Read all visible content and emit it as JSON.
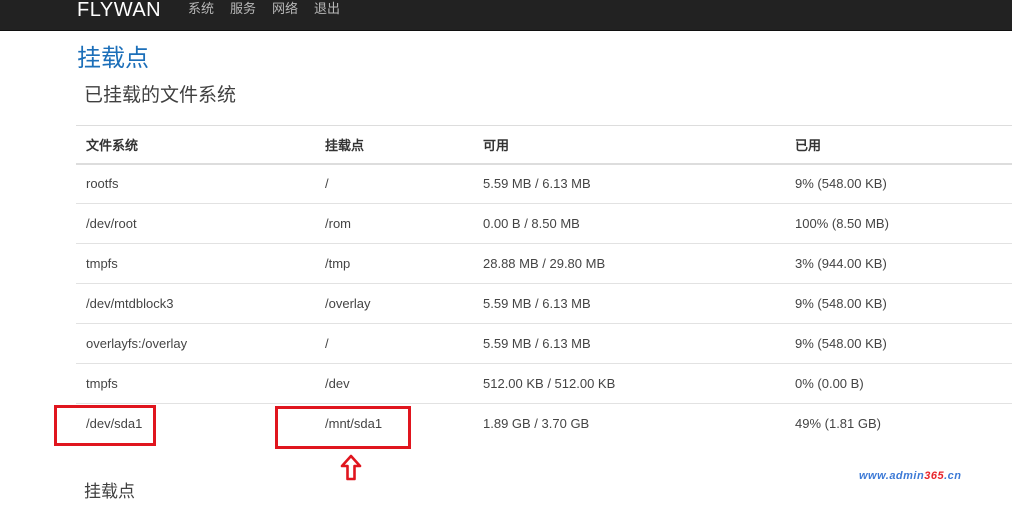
{
  "navbar": {
    "brand": "FLYWAN",
    "items": [
      "系统",
      "服务",
      "网络",
      "退出"
    ]
  },
  "page_title": "挂载点",
  "section_title": "已挂载的文件系统",
  "table": {
    "headers": [
      "文件系统",
      "挂载点",
      "可用",
      "已用"
    ],
    "rows": [
      [
        "rootfs",
        "/",
        "5.59 MB / 6.13 MB",
        "9% (548.00 KB)"
      ],
      [
        "/dev/root",
        "/rom",
        "0.00 B / 8.50 MB",
        "100% (8.50 MB)"
      ],
      [
        "tmpfs",
        "/tmp",
        "28.88 MB / 29.80 MB",
        "3% (944.00 KB)"
      ],
      [
        "/dev/mtdblock3",
        "/overlay",
        "5.59 MB / 6.13 MB",
        "9% (548.00 KB)"
      ],
      [
        "overlayfs:/overlay",
        "/",
        "5.59 MB / 6.13 MB",
        "9% (548.00 KB)"
      ],
      [
        "tmpfs",
        "/dev",
        "512.00 KB / 512.00 KB",
        "0% (0.00 B)"
      ],
      [
        "/dev/sda1",
        "/mnt/sda1",
        "1.89 GB / 3.70 GB",
        "49% (1.81 GB)"
      ]
    ]
  },
  "footer_title": "挂载点",
  "watermark": {
    "prefix": "www.admin",
    "highlight": "365",
    "suffix": ".cn"
  },
  "colors": {
    "navbar_bg": "#222222",
    "title_blue": "#1c6fb9",
    "highlight_red": "#e0151e"
  },
  "icons": {
    "annotation_arrow": "arrow-up-icon"
  }
}
